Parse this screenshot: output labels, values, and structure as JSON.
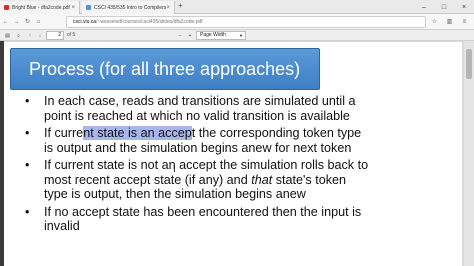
{
  "tabs": [
    {
      "title": "Bright Blue - dfa2code.pdf",
      "close": "×"
    },
    {
      "title": "CSCI 435/535 Intro to Compilers",
      "close": "×"
    }
  ],
  "new_tab": "+",
  "window_buttons": {
    "minimize": "–",
    "maximize": "□",
    "close": "×"
  },
  "nav": {
    "back": "←",
    "forward": "→",
    "reload": "↻",
    "home": "⌂"
  },
  "address": {
    "host": "csci.viu.ca",
    "path": "/~wesselsd/courses/csci435/slides/dfa2code.pdf"
  },
  "pdf_toolbar": {
    "sidebar_toggle": "▤",
    "search": "⌕",
    "prev": "↑",
    "next": "↓",
    "page": "2",
    "page_count": "of 5",
    "zoom_out": "–",
    "zoom_in": "+",
    "zoom": "Page Width"
  },
  "slide": {
    "title": "Process (for all three approaches)",
    "bullet_char": "•",
    "bullets": [
      {
        "lines": [
          "In each case, reads and transitions are simulated until a",
          "point is reached at which no valid transition is available"
        ]
      },
      {
        "l1_pre": "If curre",
        "l1_hl": "nt state is an accep",
        "l1_post": "t the corresponding token type",
        "line2": "is output and the simulation begins anew for next token"
      },
      {
        "l1": "If current state is not an accept the simulation rolls back to",
        "l2_pre": "most recent accept state (if any) and ",
        "l2_em": "that",
        "l2_post": " state's token",
        "l3": "type is output, then the simulation begins anew"
      },
      {
        "lines": [
          "If no accept state has been encountered then the input is",
          "invalid"
        ]
      }
    ]
  }
}
